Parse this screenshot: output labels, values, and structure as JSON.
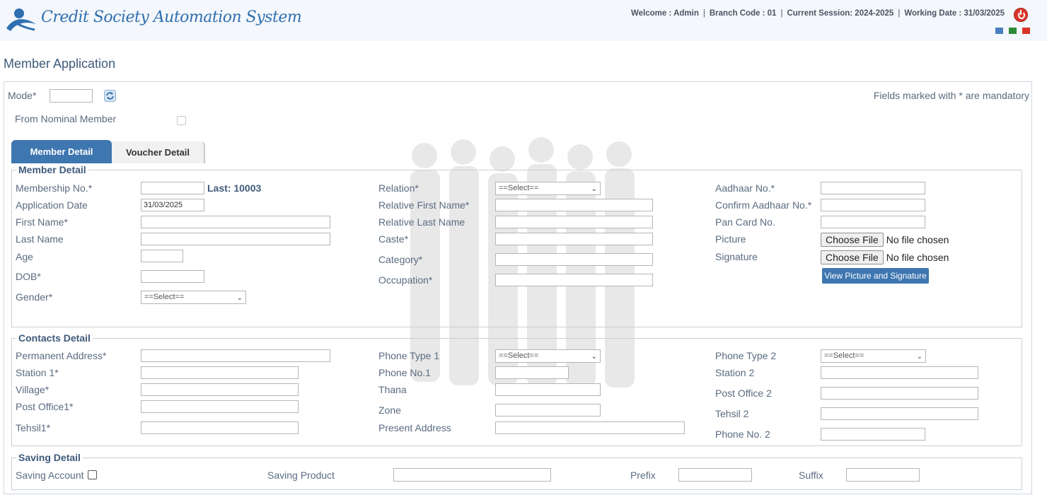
{
  "header": {
    "app_title": "Credit Society Automation System",
    "welcome": "Welcome : Admin",
    "branch": "Branch Code : 01",
    "session": "Current Session: 2024-2025",
    "working_date": "Working Date : 31/03/2025",
    "theme_colors": [
      "#4a7fc1",
      "#2e8b3a",
      "#d9342b"
    ]
  },
  "page": {
    "title": "Member Application",
    "mode_label": "Mode*",
    "mode_value": "",
    "mandatory_note": "Fields marked with * are mandatory",
    "from_nominal_label": "From Nominal Member"
  },
  "tabs": [
    {
      "label": "Member Detail",
      "active": true
    },
    {
      "label": "Voucher Detail",
      "active": false
    }
  ],
  "member_detail": {
    "legend": "Member Detail",
    "membership_no_label": "Membership No.*",
    "last_label": "Last: 10003",
    "application_date_label": "Application Date",
    "application_date_value": "31/03/2025",
    "first_name_label": "First Name*",
    "last_name_label": "Last Name",
    "age_label": "Age",
    "dob_label": "DOB*",
    "gender_label": "Gender*",
    "gender_select": "==Select==",
    "relation_label": "Relation*",
    "relation_select": "==Select==",
    "relative_first_label": "Relative First Name*",
    "relative_last_label": "Relative Last Name",
    "caste_label": "Caste*",
    "category_label": "Category*",
    "occupation_label": "Occupation*",
    "aadhaar_label": "Aadhaar No.*",
    "confirm_aadhaar_label": "Confirm Aadhaar No.*",
    "pan_label": "Pan Card No.",
    "picture_label": "Picture",
    "signature_label": "Signature",
    "choose_file": "Choose File",
    "no_file": "No file chosen",
    "view_button": "View Picture and Signature"
  },
  "contacts_detail": {
    "legend": "Contacts Detail",
    "permanent_address_label": "Permanent Address*",
    "station1_label": "Station 1*",
    "village_label": "Village*",
    "post_office1_label": "Post Office1*",
    "tehsil1_label": "Tehsil1*",
    "phone_type1_label": "Phone Type 1",
    "phone_type1_select": "==Select==",
    "phone_no1_label": "Phone No.1",
    "thana_label": "Thana",
    "zone_label": "Zone",
    "present_address_label": "Present Address",
    "phone_type2_label": "Phone Type 2",
    "phone_type2_select": "==Select==",
    "station2_label": "Station 2",
    "post_office2_label": "Post Office 2",
    "tehsil2_label": "Tehsil 2",
    "phone_no2_label": "Phone No. 2"
  },
  "saving_detail": {
    "legend": "Saving Detail",
    "saving_account_label": "Saving Account",
    "saving_product_label": "Saving Product",
    "prefix_label": "Prefix",
    "suffix_label": "Suffix"
  }
}
